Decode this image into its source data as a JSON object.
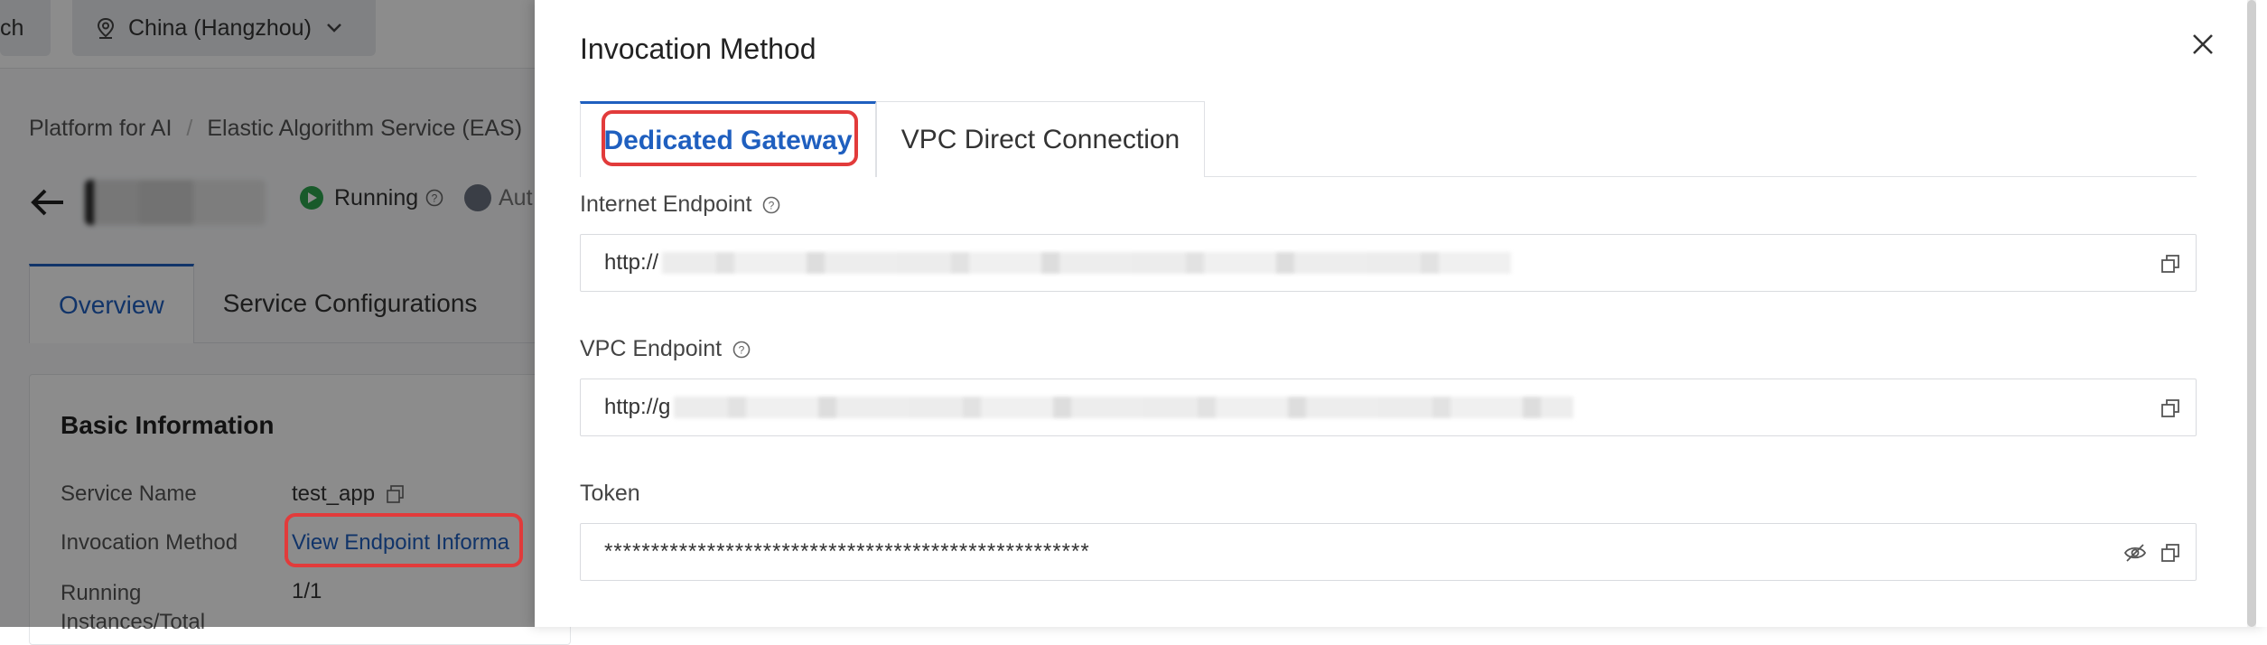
{
  "background": {
    "topbar": {
      "search_chip_label": "ch",
      "region_label": "China (Hangzhou)"
    },
    "breadcrumb": [
      "Platform for AI",
      "Elastic Algorithm Service (EAS)"
    ],
    "status": {
      "running": "Running",
      "auto": "Aut"
    },
    "tabs": [
      "Overview",
      "Service Configurations"
    ],
    "basic_info": {
      "title": "Basic Information",
      "rows": [
        {
          "label": "Service Name",
          "value": "test_app"
        },
        {
          "label": "Invocation Method",
          "value": "View Endpoint Informa"
        },
        {
          "label": "Running\nInstances/Total",
          "value": "1/1"
        }
      ]
    }
  },
  "drawer": {
    "title": "Invocation Method",
    "tabs": [
      "Dedicated Gateway",
      "VPC Direct Connection"
    ],
    "active_tab_index": 0,
    "internet_endpoint": {
      "label": "Internet Endpoint",
      "value_prefix": "http://"
    },
    "vpc_endpoint": {
      "label": "VPC Endpoint",
      "value_prefix": "http://g"
    },
    "token": {
      "label": "Token",
      "value": "****************************************************"
    }
  },
  "colors": {
    "accent": "#1f5fbf",
    "highlight": "#e23b3b",
    "running": "#2da44e"
  },
  "icons": [
    "location-pin-icon",
    "chevron-down-icon",
    "back-arrow-icon",
    "help-icon",
    "copy-icon",
    "eye-off-icon",
    "close-icon"
  ]
}
